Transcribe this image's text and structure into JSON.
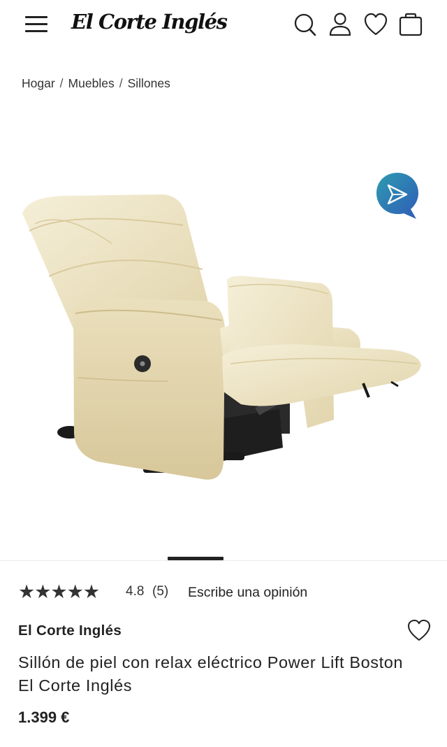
{
  "header": {
    "logo": "El Corte Inglés",
    "icons": [
      "menu-icon",
      "search-icon",
      "user-icon",
      "heart-icon",
      "bag-icon"
    ]
  },
  "breadcrumb": [
    "Hogar",
    "Muebles",
    "Sillones"
  ],
  "gallery": {
    "image_subject": "cream leather power recliner armchair",
    "ar_badge_icon": "augmented-reality-icon",
    "current_slide": 1
  },
  "rating": {
    "stars": "★★★★★",
    "value": "4.8",
    "count": "(5)",
    "write_review": "Escribe una opinión"
  },
  "product": {
    "brand": "El Corte Inglés",
    "title": "Sillón de piel con relax eléctrico Power Lift Boston El Corte Inglés",
    "price": "1.399 €"
  },
  "colors": {
    "text": "#222222",
    "leather": "#efe5c6",
    "ar_badge_blue": "#2f5bb8",
    "ar_badge_teal": "#2e9bb0"
  }
}
